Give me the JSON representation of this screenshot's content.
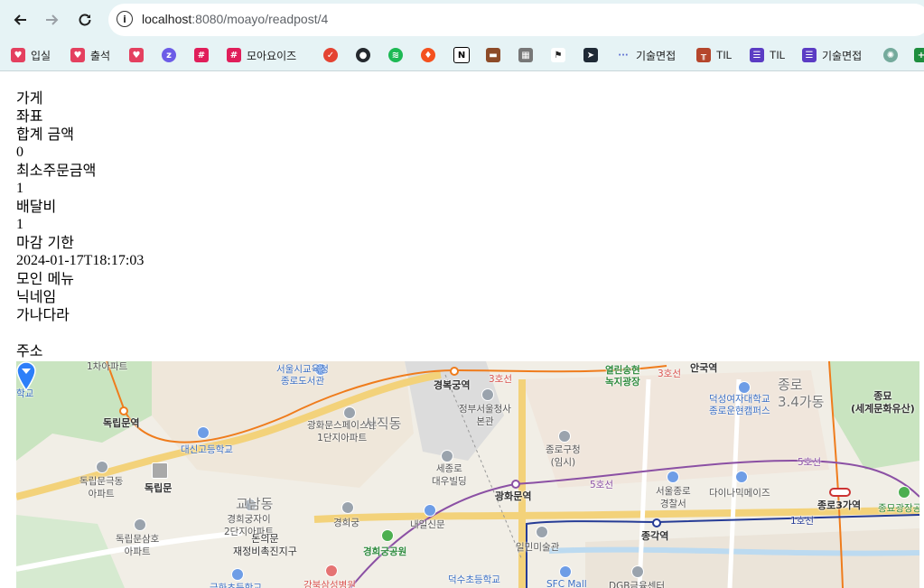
{
  "browser": {
    "url_host": "localhost",
    "url_rest": ":8080/moayo/readpost/4",
    "bookmarks": [
      {
        "label": "입실",
        "icon": "heart-badge-icon",
        "color": "#e4405f"
      },
      {
        "label": "출석",
        "icon": "heart-badge-icon",
        "color": "#e4405f"
      },
      {
        "label": "",
        "icon": "heart-badge-icon",
        "color": "#e4405f"
      },
      {
        "label": "",
        "icon": "zap-icon",
        "color": "#6c5ce7"
      },
      {
        "label": "",
        "icon": "slack-icon",
        "color": "#e01e5a"
      },
      {
        "label": "모아요이즈",
        "icon": "slack-icon",
        "color": "#e01e5a"
      },
      {
        "label": "",
        "icon": "todoist-icon",
        "color": "#e44332"
      },
      {
        "label": "",
        "icon": "github-icon",
        "color": "#24292e"
      },
      {
        "label": "",
        "icon": "spotify-icon",
        "color": "#1db954"
      },
      {
        "label": "",
        "icon": "flame-icon",
        "color": "#f4511e"
      },
      {
        "label": "",
        "icon": "notion-icon",
        "color": "#000000"
      },
      {
        "label": "",
        "icon": "briefcase-icon",
        "color": "#8d4b28"
      },
      {
        "label": "",
        "icon": "grid-icon",
        "color": "#555555"
      },
      {
        "label": "",
        "icon": "checkered-flag-icon",
        "color": "#222222"
      },
      {
        "label": "",
        "icon": "arrow-app-icon",
        "color": "#1f2a36"
      },
      {
        "label": "기술면접",
        "icon": "dots-icon",
        "color": "#5b6dd1"
      },
      {
        "label": "TIL",
        "icon": "bridge-icon",
        "color": "#b5462c"
      },
      {
        "label": "TIL",
        "icon": "list-icon",
        "color": "#5b3cc4"
      },
      {
        "label": "기술면접",
        "icon": "list-icon",
        "color": "#5b3cc4"
      },
      {
        "label": "",
        "icon": "openai-icon",
        "color": "#74aa9c"
      },
      {
        "label": "",
        "icon": "plus-sheet-icon",
        "color": "#1e8e3e"
      }
    ]
  },
  "post": {
    "store_label": "가게",
    "coord_label": "좌표",
    "total_label": "합계 금액",
    "total_value": "0",
    "min_order_label": "최소주문금액",
    "min_order_value": "1",
    "delivery_fee_label": "배달비",
    "delivery_fee_value": "1",
    "deadline_label": "마감 기한",
    "deadline_value": "2024-01-17T18:17:03",
    "menu_label": "모인 메뉴",
    "nickname_label": "닉네임",
    "nickname_value": "가나다라",
    "address_label": "주소"
  },
  "map": {
    "labels": {
      "apt1": "1차아파트",
      "school_tl": "학교",
      "edu_library": "서울시교육청\n종로도서관",
      "gyeongbok": "경복궁역",
      "line3a": "3호선",
      "line3b": "3호선",
      "yeolin": "열린송현\n녹지광장",
      "anguk": "안국역",
      "duksung": "덕성여자대학교\n종로운현캠퍼스",
      "jongno_dong": "종로\n3.4가동",
      "jongmyo": "종묘\n(세계문화유산)",
      "dongnimmun_stn": "독립문역",
      "gwanghwamun_apt": "광화문스페이스본\n1단지아파트",
      "sajik": "사직동",
      "govt_complex": "정부서울청사\n본관",
      "daesin": "대신고등학교",
      "sejong": "세종로\n대우빌딩",
      "jongno_office": "종로구청\n(임시)",
      "dongnip_park": "독립문극동\n아파트",
      "dongnimmun": "독립문",
      "gwanghwamun_stn": "광화문역",
      "line5a": "5호선",
      "line5b": "5호선",
      "seoul_jongno_police": "서울종로\n경찰서",
      "diamatrix": "다이나믹메이즈",
      "jongno3ga": "종로3가역",
      "jongmyo_plaza": "종묘광장공원",
      "gyodong": "교남동",
      "gyeonghuigung_apt": "경희궁자이\n2단지아파트",
      "gyeonghuigung": "경희궁",
      "naeil": "내일신문",
      "dongnimmun_samho": "독립문삼호\n아파트",
      "redevelop": "돈의문\n재정비촉진지구",
      "gyeonghuigung_park": "경희궁공원",
      "ilmin": "일민미술관",
      "jonggak": "종각역",
      "line1": "1호선",
      "deoksu": "덕수초등학교",
      "kangbuk": "강북삼성병원",
      "sfc": "SFC Mall",
      "dgb": "DGB금융센터",
      "school_bl": "금화초등학교"
    }
  }
}
